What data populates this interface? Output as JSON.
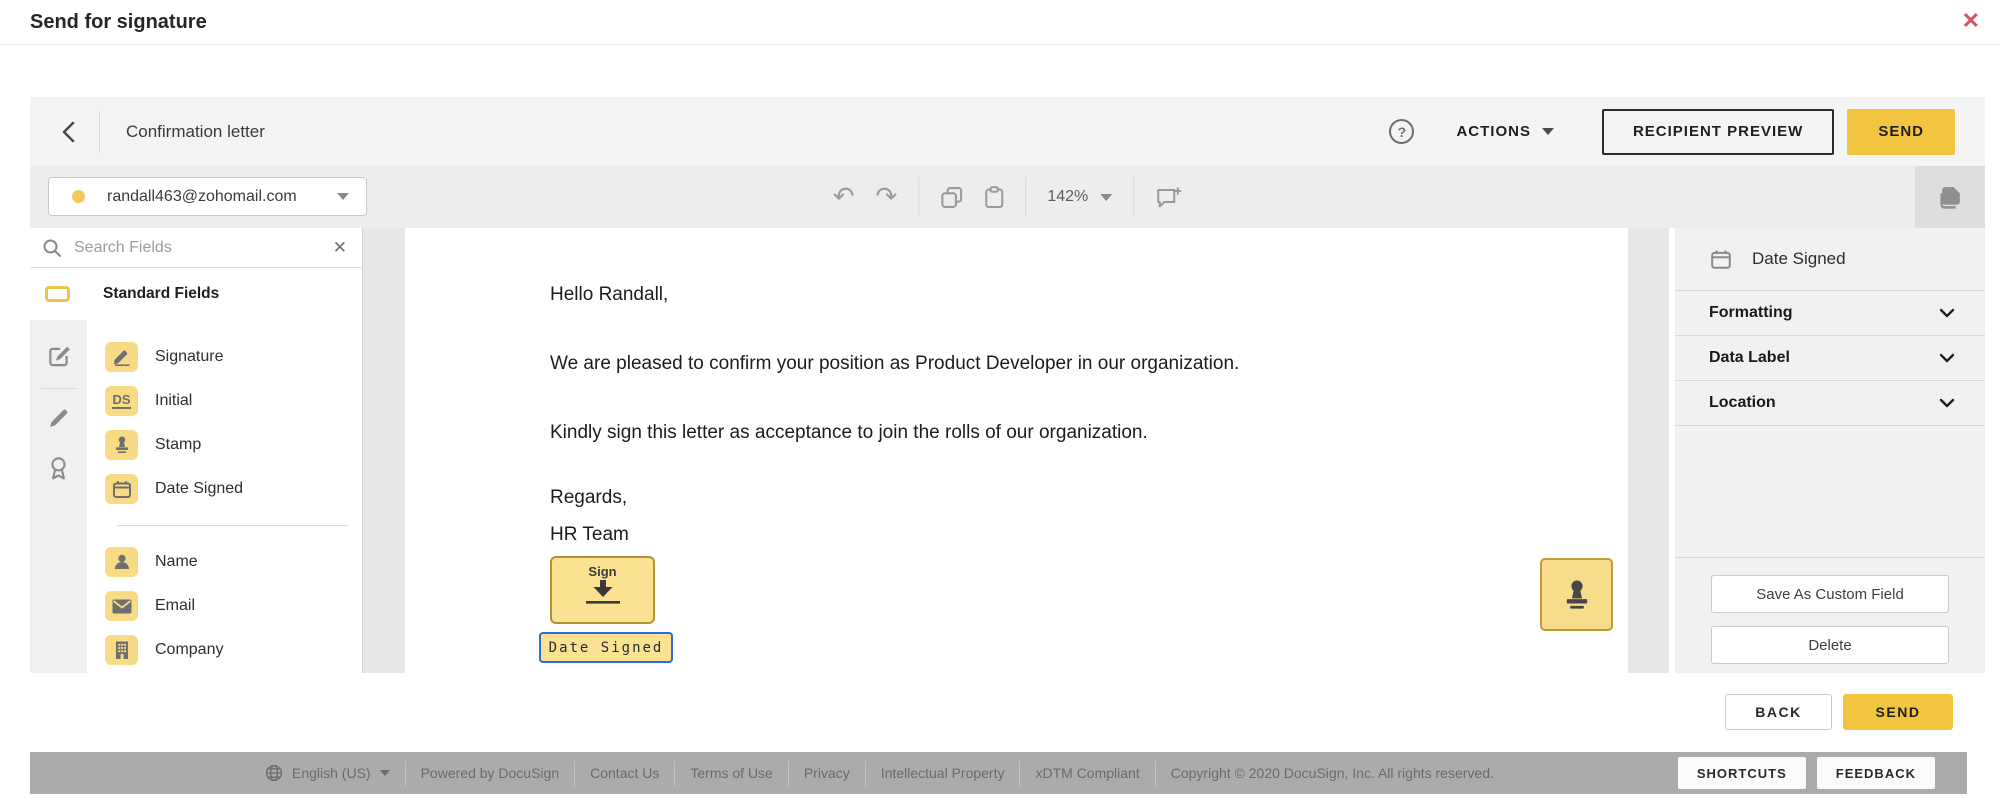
{
  "colors": {
    "accent_yellow": "#f1c53f",
    "field_yellow": "#fae292",
    "selected_blue": "#2e6bd8",
    "close_red": "#d4535f",
    "footer_gray": "#ababab"
  },
  "modal": {
    "title": "Send for signature",
    "close_glyph": "✕"
  },
  "toolbar": {
    "document_title": "Confirmation letter",
    "help_glyph": "?",
    "actions_label": "ACTIONS",
    "recipient_preview_label": "RECIPIENT PREVIEW",
    "send_label": "SEND"
  },
  "editor_bar": {
    "recipient_email": "randall463@zohomail.com",
    "zoom_level": "142%",
    "undo_glyph": "↶",
    "redo_glyph": "↷"
  },
  "left_sidebar": {
    "search_placeholder": "Search Fields",
    "clear_glyph": "✕",
    "section_title": "Standard Fields",
    "fields": [
      {
        "label": "Signature",
        "icon": "signature-icon"
      },
      {
        "label": "Initial",
        "icon": "initial-icon",
        "badge": "DS"
      },
      {
        "label": "Stamp",
        "icon": "stamp-icon"
      },
      {
        "label": "Date Signed",
        "icon": "calendar-icon"
      },
      {
        "label": "Name",
        "icon": "person-icon"
      },
      {
        "label": "Email",
        "icon": "envelope-icon"
      },
      {
        "label": "Company",
        "icon": "building-icon"
      }
    ]
  },
  "document": {
    "paragraphs": [
      "Hello Randall,",
      "We are pleased to confirm your position as Product Developer in our organization.",
      "Kindly sign this letter as acceptance to join the rolls of our organization.",
      "Regards,",
      "HR Team"
    ],
    "sign_field_label": "Sign",
    "date_signed_field_label": "Date Signed"
  },
  "right_panel": {
    "field_title": "Date Signed",
    "sections": [
      {
        "label": "Formatting"
      },
      {
        "label": "Data Label"
      },
      {
        "label": "Location"
      }
    ],
    "save_button": "Save As Custom Field",
    "delete_button": "Delete"
  },
  "bottom_bar": {
    "back_label": "BACK",
    "send_label": "SEND"
  },
  "footer": {
    "language": "English (US)",
    "links": [
      "Powered by DocuSign",
      "Contact Us",
      "Terms of Use",
      "Privacy",
      "Intellectual Property",
      "xDTM Compliant"
    ],
    "copyright": "Copyright © 2020 DocuSign, Inc. All rights reserved.",
    "shortcuts_label": "SHORTCUTS",
    "feedback_label": "FEEDBACK"
  }
}
